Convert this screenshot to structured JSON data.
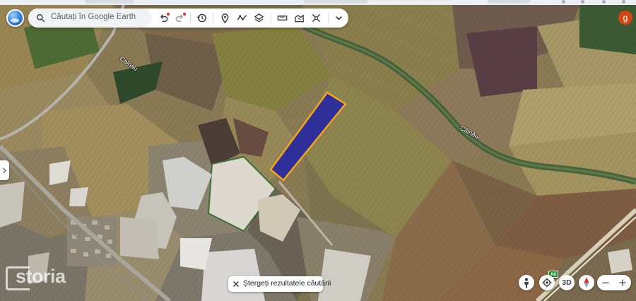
{
  "search": {
    "placeholder": "Căutați în Google Earth"
  },
  "toolbar": {
    "icons": [
      "undo-icon",
      "redo-icon",
      "history-icon",
      "add-placemark-icon",
      "add-path-icon",
      "layers-icon",
      "measure-icon",
      "map-style-icon",
      "fullscreen-collapse-icon",
      "chevron-down-icon"
    ]
  },
  "account": {
    "initial": "g",
    "color": "#d44512"
  },
  "map": {
    "road_labels": [
      "Calnau",
      "Călnău"
    ],
    "road_sign": "A0",
    "highlight_fill": "#2f2f9a",
    "highlight_stroke": "#f3a51c"
  },
  "clear_results": {
    "label": "Ștergeți rezultatele căutării"
  },
  "controls": {
    "three_d_label": "3D",
    "zoom_out": "−",
    "zoom_in": "+"
  },
  "watermark": {
    "text": "storia"
  }
}
